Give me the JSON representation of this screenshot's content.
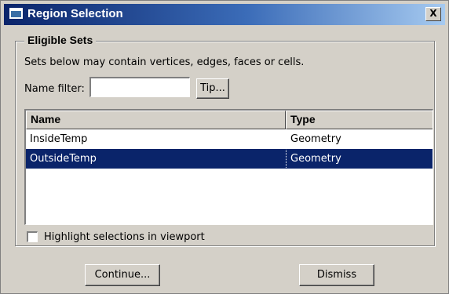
{
  "window": {
    "title": "Region Selection",
    "close_label": "X"
  },
  "group": {
    "legend": "Eligible Sets",
    "description": "Sets below may contain vertices, edges, faces or cells."
  },
  "filter": {
    "label": "Name filter:",
    "value": "",
    "tip_label": "Tip..."
  },
  "table": {
    "columns": [
      "Name",
      "Type"
    ],
    "rows": [
      {
        "name": "InsideTemp",
        "type": "Geometry",
        "selected": false
      },
      {
        "name": "OutsideTemp",
        "type": "Geometry",
        "selected": true
      }
    ]
  },
  "highlight": {
    "label": "Highlight selections in viewport",
    "checked": false
  },
  "buttons": {
    "continue_label": "Continue...",
    "dismiss_label": "Dismiss"
  },
  "colors": {
    "selection": "#0a246a",
    "face": "#d4d0c8"
  }
}
